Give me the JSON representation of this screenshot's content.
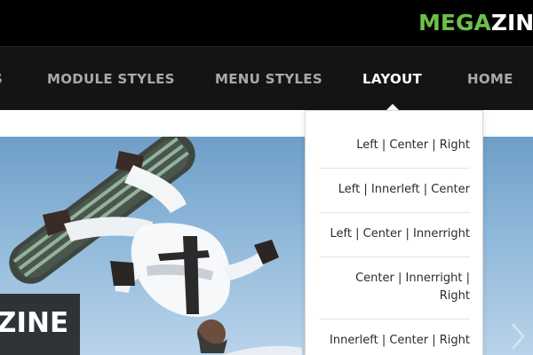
{
  "brand": {
    "part1": "MEGA",
    "part2": "ZINE",
    "part1_color": "#6cc04a",
    "part2_color": "#ffffff"
  },
  "nav": {
    "items": [
      {
        "label": "S",
        "active": false
      },
      {
        "label": "MODULE STYLES",
        "active": false
      },
      {
        "label": "MENU STYLES",
        "active": false
      },
      {
        "label": "LAYOUT",
        "active": true
      },
      {
        "label": "HOME",
        "active": false
      }
    ]
  },
  "layout_menu": {
    "items": [
      {
        "label": "Left  |  Center  |  Right"
      },
      {
        "label": "Left  |  Innerleft  |  Center"
      },
      {
        "label": "Left  |  Center  |  Innerright"
      },
      {
        "label": "Center  |  Innerright  |\nRight"
      },
      {
        "label": "Innerleft  |  Center  |  Right"
      }
    ]
  },
  "slider": {
    "caption": "ZINE",
    "next_icon": "chevron-right-icon"
  },
  "colors": {
    "topbar": "#000000",
    "navbar": "#141414",
    "nav_text": "#a9a9a9",
    "nav_active": "#ffffff",
    "accent": "#6cc04a"
  }
}
